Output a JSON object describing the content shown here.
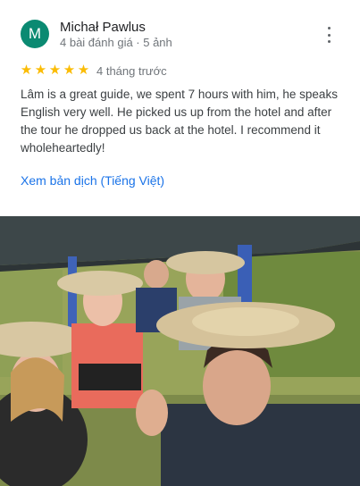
{
  "reviewer": {
    "initial": "M",
    "name": "Michał Pawlus",
    "stats": "4 bài đánh giá · 5 ảnh",
    "avatar_color": "#0b8a72"
  },
  "menu": {
    "icon": "more-vert-icon"
  },
  "review": {
    "rating": 5,
    "time": "4 tháng trước",
    "text": "Lâm is a great guide, we spent 7 hours with him, he speaks English very well. He picked us up from the hotel and after the tour he dropped us back at the hotel. I recommend it wholeheartedly!",
    "translate_link": "Xem bản dịch (Tiếng Việt)"
  },
  "photo": {
    "subject": "group-selfie-boat-photo"
  },
  "colors": {
    "star": "#fbbc04",
    "link": "#1a73e8"
  }
}
